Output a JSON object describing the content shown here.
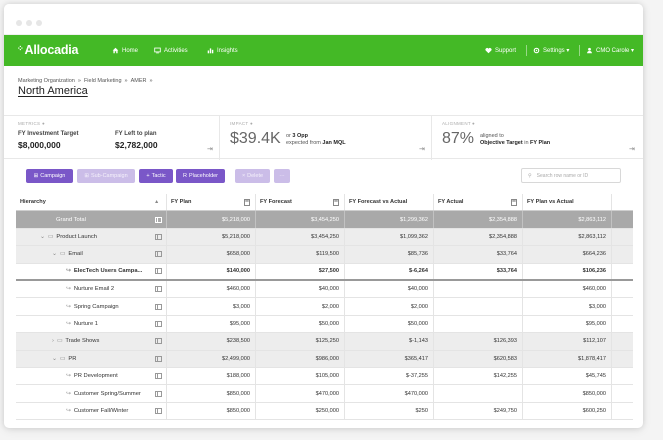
{
  "brand": {
    "name": "Allocadia",
    "accent": "#44b926",
    "purple": "#7a57c8"
  },
  "nav": {
    "items": [
      {
        "label": "Home",
        "icon": "home-icon"
      },
      {
        "label": "Activities",
        "icon": "monitor-icon"
      },
      {
        "label": "Insights",
        "icon": "bar-chart-icon"
      }
    ],
    "right": [
      {
        "label": "Support",
        "icon": "heart-icon"
      },
      {
        "label": "Settings ▾",
        "icon": "gear-icon"
      },
      {
        "label": "CMO Carole ▾",
        "icon": "user-icon"
      }
    ]
  },
  "breadcrumb": [
    "Marketing Organization",
    "Field Marketing",
    "AMER"
  ],
  "page_title": "North America",
  "metrics": {
    "heading": "METRICS",
    "investment_label": "FY Investment Target",
    "investment_value": "$8,000,000",
    "left_label": "FY Left to plan",
    "left_value": "$2,782,000",
    "impact_heading": "IMPACT",
    "impact_value": "$39.4K",
    "impact_or": "or",
    "impact_opp": "3 Opp",
    "impact_expected": "expected from",
    "impact_source": "Jan MQL",
    "alignment_heading": "ALIGNMENT",
    "alignment_value": "87%",
    "alignment_text": "aligned to",
    "alignment_target": "Objective Target",
    "alignment_in": "in",
    "alignment_plan": "FY Plan"
  },
  "toolbar": {
    "buttons": [
      {
        "label": "Campaign",
        "icon": "grid-icon",
        "enabled": true
      },
      {
        "label": "Sub-Campaign",
        "icon": "grid-icon",
        "enabled": false
      },
      {
        "label": "Tactic",
        "icon": "plus-icon",
        "enabled": true
      },
      {
        "label": "Placeholder",
        "icon": "placeholder-icon",
        "enabled": true
      },
      {
        "label": "Delete",
        "icon": "x-icon",
        "enabled": false
      },
      {
        "label": "",
        "icon": "more-icon",
        "enabled": false
      }
    ],
    "search_placeholder": "Search row name or ID"
  },
  "table": {
    "columns": [
      "Hierarchy",
      "FY Plan",
      "FY Forecast",
      "FY Forecast vs Actual",
      "FY Actual",
      "FY Plan vs Actual"
    ],
    "rows": [
      {
        "name": "Grand Total",
        "type": "grand",
        "level": 0,
        "values": [
          "$5,218,000",
          "$3,454,250",
          "$1,299,362",
          "$2,354,888",
          "$2,863,112"
        ]
      },
      {
        "name": "Product Launch",
        "type": "folder",
        "level": 1,
        "expanded": true,
        "values": [
          "$5,218,000",
          "$3,454,250",
          "$1,099,362",
          "$2,354,888",
          "$2,863,112"
        ]
      },
      {
        "name": "Email",
        "type": "folder",
        "level": 2,
        "expanded": true,
        "values": [
          "$658,000",
          "$119,500",
          "$85,736",
          "$33,764",
          "$664,236"
        ]
      },
      {
        "name": "ElecTech Users Campa...",
        "type": "item",
        "level": 3,
        "selected": true,
        "values": [
          "$140,000",
          "$27,500",
          "$-6,264",
          "$33,764",
          "$106,236"
        ]
      },
      {
        "name": "Nurture Email 2",
        "type": "item",
        "level": 3,
        "values": [
          "$460,000",
          "$40,000",
          "$40,000",
          "",
          "$460,000"
        ]
      },
      {
        "name": "Spring Campaign",
        "type": "item",
        "level": 3,
        "values": [
          "$3,000",
          "$2,000",
          "$2,000",
          "",
          "$3,000"
        ]
      },
      {
        "name": "Nurture 1",
        "type": "item",
        "level": 3,
        "values": [
          "$95,000",
          "$50,000",
          "$50,000",
          "",
          "$95,000"
        ]
      },
      {
        "name": "Trade Shows",
        "type": "folder",
        "level": 2,
        "expanded": false,
        "values": [
          "$238,500",
          "$125,250",
          "$-1,143",
          "$126,393",
          "$112,107"
        ]
      },
      {
        "name": "PR",
        "type": "folder",
        "level": 2,
        "expanded": true,
        "values": [
          "$2,499,000",
          "$986,000",
          "$365,417",
          "$620,583",
          "$1,878,417"
        ]
      },
      {
        "name": "PR Development",
        "type": "item",
        "level": 3,
        "values": [
          "$188,000",
          "$105,000",
          "$-37,255",
          "$142,255",
          "$45,745"
        ]
      },
      {
        "name": "Customer Spring/Summer",
        "type": "item",
        "level": 3,
        "values": [
          "$850,000",
          "$470,000",
          "$470,000",
          "",
          "$850,000"
        ]
      },
      {
        "name": "Customer Fall/Winter",
        "type": "item",
        "level": 3,
        "values": [
          "$850,000",
          "$250,000",
          "$250",
          "$249,750",
          "$600,250"
        ]
      }
    ]
  }
}
